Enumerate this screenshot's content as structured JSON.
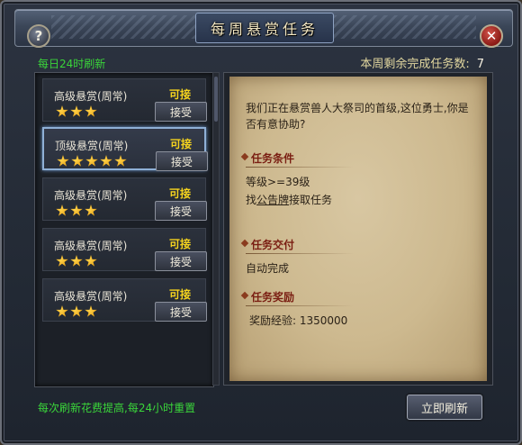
{
  "window": {
    "title": "每周悬赏任务"
  },
  "header": {
    "refresh_info": "每日24时刷新",
    "remaining_label": "本周剩余完成任务数:",
    "remaining_count": "7"
  },
  "tasks": [
    {
      "name": "高级悬赏(周常)",
      "status": "可接",
      "stars": 3,
      "button": "接受",
      "selected": false
    },
    {
      "name": "顶级悬赏(周常)",
      "status": "可接",
      "stars": 5,
      "button": "接受",
      "selected": true
    },
    {
      "name": "高级悬赏(周常)",
      "status": "可接",
      "stars": 3,
      "button": "接受",
      "selected": false
    },
    {
      "name": "高级悬赏(周常)",
      "status": "可接",
      "stars": 3,
      "button": "接受",
      "selected": false
    },
    {
      "name": "高级悬赏(周常)",
      "status": "可接",
      "stars": 3,
      "button": "接受",
      "selected": false
    }
  ],
  "detail": {
    "intro": "我们正在悬赏兽人大祭司的首级,这位勇士,你是否有意协助?",
    "conditions_title": "任务条件",
    "condition_level": "等级>=39级",
    "condition_find_prefix": "找",
    "condition_find_link": "公告牌",
    "condition_find_suffix": "接取任务",
    "delivery_title": "任务交付",
    "delivery_text": "自动完成",
    "reward_title": "任务奖励",
    "reward_text": "奖励经验: 1350000"
  },
  "footer": {
    "note": "每次刷新花费提高,每24小时重置",
    "refresh_button": "立即刷新"
  },
  "colors": {
    "green_text": "#3ad53a",
    "status_yellow": "#f4d21e",
    "section_red": "#7a1e12",
    "close_red": "#c0392b"
  },
  "icons": {
    "help": "?",
    "close": "✕"
  }
}
